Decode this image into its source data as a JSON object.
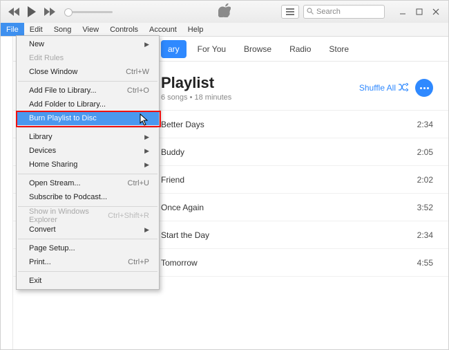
{
  "titlebar": {
    "search_placeholder": "Search"
  },
  "menubar": {
    "items": [
      "File",
      "Edit",
      "Song",
      "View",
      "Controls",
      "Account",
      "Help"
    ],
    "active": "File"
  },
  "tabs": {
    "items": [
      "Library",
      "For You",
      "Browse",
      "Radio",
      "Store"
    ],
    "selected_suffix": "ary"
  },
  "playlist": {
    "title": "Playlist",
    "subtitle": "6 songs • 18 minutes",
    "shuffle_label": "Shuffle All"
  },
  "tracks": [
    {
      "name": "Better Days",
      "duration": "2:34"
    },
    {
      "name": "Buddy",
      "duration": "2:05"
    },
    {
      "name": "Friend",
      "duration": "2:02"
    },
    {
      "name": "Once Again",
      "duration": "3:52"
    },
    {
      "name": "Start the Day",
      "duration": "2:34"
    },
    {
      "name": "Tomorrow",
      "duration": "4:55"
    }
  ],
  "file_menu": [
    {
      "type": "item",
      "label": "New",
      "submenu": true
    },
    {
      "type": "item",
      "label": "Edit Rules",
      "disabled": true
    },
    {
      "type": "item",
      "label": "Close Window",
      "shortcut": "Ctrl+W"
    },
    {
      "type": "sep"
    },
    {
      "type": "item",
      "label": "Add File to Library...",
      "shortcut": "Ctrl+O"
    },
    {
      "type": "item",
      "label": "Add Folder to Library..."
    },
    {
      "type": "item",
      "label": "Burn Playlist to Disc",
      "highlight": true
    },
    {
      "type": "sep"
    },
    {
      "type": "item",
      "label": "Library",
      "submenu": true
    },
    {
      "type": "item",
      "label": "Devices",
      "submenu": true
    },
    {
      "type": "item",
      "label": "Home Sharing",
      "submenu": true
    },
    {
      "type": "sep"
    },
    {
      "type": "item",
      "label": "Open Stream...",
      "shortcut": "Ctrl+U"
    },
    {
      "type": "item",
      "label": "Subscribe to Podcast..."
    },
    {
      "type": "sep"
    },
    {
      "type": "item",
      "label": "Show in Windows Explorer",
      "shortcut": "Ctrl+Shift+R",
      "disabled": true
    },
    {
      "type": "item",
      "label": "Convert",
      "submenu": true
    },
    {
      "type": "sep"
    },
    {
      "type": "item",
      "label": "Page Setup..."
    },
    {
      "type": "item",
      "label": "Print...",
      "shortcut": "Ctrl+P"
    },
    {
      "type": "sep"
    },
    {
      "type": "item",
      "label": "Exit"
    }
  ]
}
